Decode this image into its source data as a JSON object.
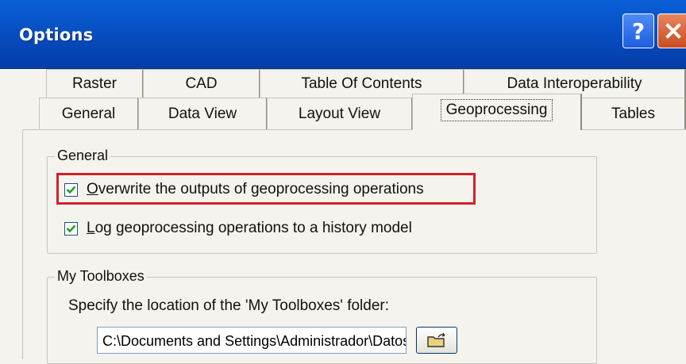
{
  "window": {
    "title": "Options"
  },
  "tabs": {
    "top_row": [
      "Raster",
      "CAD",
      "Table Of Contents",
      "Data Interoperability"
    ],
    "bottom_row": [
      "General",
      "Data View",
      "Layout View",
      "Geoprocessing",
      "Tables"
    ],
    "active": "Geoprocessing"
  },
  "general_group": {
    "label": "General",
    "overwrite": {
      "label": "Overwrite the outputs of geoprocessing operations",
      "mnemonic": "O",
      "checked": true
    },
    "log": {
      "label": "Log geoprocessing operations to a history model",
      "mnemonic": "L",
      "checked": true
    }
  },
  "toolboxes_group": {
    "label": "My Toolboxes",
    "description": "Specify the location of the 'My Toolboxes' folder:",
    "path_value": "C:\\Documents and Settings\\Administrador\\Datos de prog"
  },
  "icons": {
    "help": "help-icon",
    "close": "close-icon",
    "checkbox": "checkmark-icon",
    "browse": "open-folder-icon"
  },
  "colors": {
    "titlebar": "#0853c8",
    "highlight": "#d3202a",
    "close_button": "#d35a2c"
  }
}
